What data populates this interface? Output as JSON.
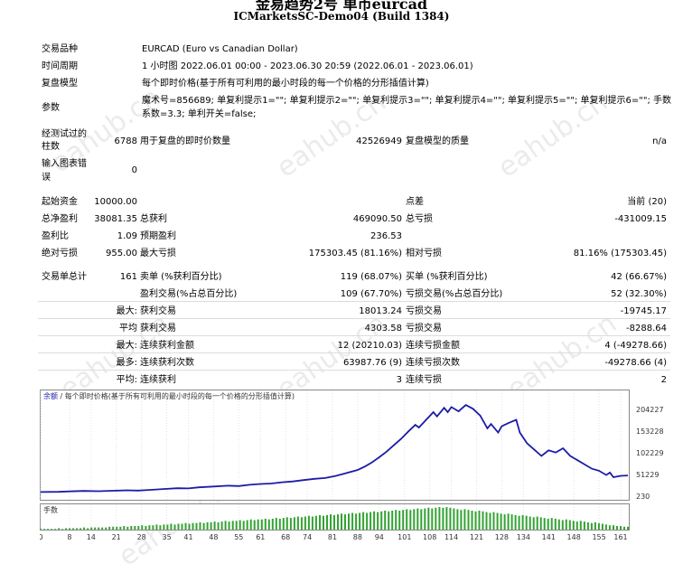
{
  "header": {
    "title": "金易趋势2号 单币eurcad",
    "subtitle": "ICMarketsSC-Demo04 (Build 1384)"
  },
  "watermark": "eahub.cn",
  "settings": {
    "symbol_label": "交易品种",
    "symbol_value": "EURCAD (Euro vs Canadian Dollar)",
    "period_label": "时间周期",
    "period_value": "1 小时图 2022.06.01 00:00 - 2023.06.30 20:59 (2022.06.01 - 2023.06.01)",
    "model_label": "复盘模型",
    "model_value": "每个即时价格(基于所有可利用的最小时段的每一个价格的分形插值计算)",
    "params_label": "参数",
    "params_line1": "魔术号=856689; 单复利提示1=\"\"; 单复利提示2=\"\"; 单复利提示3=\"\"; 单复利提示4=\"\"; 单复利提示5=\"\"; 单复利提示6=\"\"; 手数",
    "params_line2": "系数=3.3; 单利开关=false;"
  },
  "quality": {
    "bars_label_1": "经测试过的",
    "bars_label_2": "柱数",
    "bars_value": "6788",
    "ticks_label": "用于复盘的即时价数量",
    "ticks_value": "42526949",
    "model_quality_label": "复盘模型的质量",
    "model_quality_value": "n/a",
    "errors_label_1": "输入图表错",
    "errors_label_2": "误",
    "errors_value": "0"
  },
  "stats": {
    "initial_deposit_label": "起始资金",
    "initial_deposit_value": "10000.00",
    "spread_label": "点差",
    "spread_value": "当前 (20)",
    "net_profit_label": "总净盈利",
    "net_profit_value": "38081.35",
    "gross_profit_label": "总获利",
    "gross_profit_value": "469090.50",
    "gross_loss_label": "总亏损",
    "gross_loss_value": "-431009.15",
    "profit_factor_label": "盈利比",
    "profit_factor_value": "1.09",
    "expected_payoff_label": "预期盈利",
    "expected_payoff_value": "236.53",
    "abs_drawdown_label": "绝对亏损",
    "abs_drawdown_value": "955.00",
    "max_drawdown_label": "最大亏损",
    "max_drawdown_value": "175303.45 (81.16%)",
    "rel_drawdown_label": "相对亏损",
    "rel_drawdown_value": "81.16% (175303.45)"
  },
  "trades": {
    "total_label": "交易单总计",
    "total_value": "161",
    "short_label": "卖单 (%获利百分比)",
    "short_value": "119 (68.07%)",
    "long_label": "买单 (%获利百分比)",
    "long_value": "42 (66.67%)",
    "profit_trades_label": "盈利交易(%占总百分比)",
    "profit_trades_value": "109 (67.70%)",
    "loss_trades_label": "亏损交易(%占总百分比)",
    "loss_trades_value": "52 (32.30%)",
    "largest_label": "最大:",
    "largest_profit_label": "获利交易",
    "largest_profit_value": "18013.24",
    "largest_loss_label": "亏损交易",
    "largest_loss_value": "-19745.17",
    "average_label": "平均",
    "average_profit_label": "获利交易",
    "average_profit_value": "4303.58",
    "average_loss_label": "亏损交易",
    "average_loss_value": "-8288.64",
    "max_consec_label": "最大:",
    "max_consec_wins_label": "连续获利金额",
    "max_consec_wins_value": "12 (20210.03)",
    "max_consec_losses_label": "连续亏损金额",
    "max_consec_losses_value": "4 (-49278.66)",
    "max_consec_profit_label": "最多:",
    "max_consec_profit_text": "连续获利次数",
    "max_consec_profit_value": "63987.76 (9)",
    "max_consec_loss_text": "连续亏损次数",
    "max_consec_loss_value": "-49278.66 (4)",
    "avg_consec_label": "平均:",
    "avg_consec_wins_label": "连续获利",
    "avg_consec_wins_value": "3",
    "avg_consec_losses_label": "连续亏损",
    "avg_consec_losses_value": "2"
  },
  "chart_data": {
    "type": "line",
    "legend": "余额 / 每个即时价格(基于所有可利用的最小时段的每一个价格的分形插值计算)",
    "legend_balance": "余额",
    "legend_rest": " / 每个即时价格(基于所有可利用的最小时段的每一个价格的分形插值计算)",
    "volume_label": "手数",
    "ylim": [
      230,
      230000
    ],
    "yticks": [
      "204227",
      "153228",
      "102229",
      "51229",
      "230"
    ],
    "ytick_values": [
      204227,
      153228,
      102229,
      51229,
      230
    ],
    "xticks": [
      "0",
      "8",
      "14",
      "21",
      "28",
      "35",
      "41",
      "48",
      "55",
      "61",
      "68",
      "74",
      "81",
      "88",
      "94",
      "101",
      "108",
      "114",
      "121",
      "128",
      "134",
      "141",
      "148",
      "155",
      "161"
    ],
    "xlim": [
      0,
      163
    ],
    "color_line": "#1c1ca8",
    "color_volume": "#33a333",
    "balance": [
      [
        0,
        10000
      ],
      [
        5,
        10500
      ],
      [
        8,
        11500
      ],
      [
        12,
        12500
      ],
      [
        16,
        12000
      ],
      [
        20,
        13000
      ],
      [
        24,
        14000
      ],
      [
        27,
        13500
      ],
      [
        30,
        15000
      ],
      [
        34,
        17000
      ],
      [
        38,
        19000
      ],
      [
        41,
        18500
      ],
      [
        44,
        21000
      ],
      [
        48,
        23000
      ],
      [
        52,
        25000
      ],
      [
        55,
        24000
      ],
      [
        58,
        27000
      ],
      [
        61,
        29000
      ],
      [
        64,
        30000
      ],
      [
        67,
        33000
      ],
      [
        70,
        35000
      ],
      [
        73,
        38000
      ],
      [
        76,
        41000
      ],
      [
        79,
        43000
      ],
      [
        82,
        48000
      ],
      [
        85,
        55000
      ],
      [
        88,
        62000
      ],
      [
        90,
        70000
      ],
      [
        92,
        80000
      ],
      [
        94,
        92000
      ],
      [
        96,
        105000
      ],
      [
        98,
        120000
      ],
      [
        100,
        135000
      ],
      [
        102,
        152000
      ],
      [
        104,
        168000
      ],
      [
        105,
        162000
      ],
      [
        107,
        180000
      ],
      [
        109,
        198000
      ],
      [
        110,
        188000
      ],
      [
        112,
        208000
      ],
      [
        113,
        198000
      ],
      [
        114,
        210000
      ],
      [
        116,
        200000
      ],
      [
        118,
        215000
      ],
      [
        120,
        206000
      ],
      [
        122,
        190000
      ],
      [
        124,
        160000
      ],
      [
        125,
        170000
      ],
      [
        127,
        150000
      ],
      [
        128,
        165000
      ],
      [
        130,
        173000
      ],
      [
        132,
        180000
      ],
      [
        133,
        150000
      ],
      [
        135,
        125000
      ],
      [
        137,
        110000
      ],
      [
        139,
        95000
      ],
      [
        141,
        108000
      ],
      [
        143,
        103000
      ],
      [
        145,
        113000
      ],
      [
        147,
        95000
      ],
      [
        149,
        85000
      ],
      [
        151,
        75000
      ],
      [
        153,
        65000
      ],
      [
        155,
        60000
      ],
      [
        157,
        50000
      ],
      [
        158,
        56000
      ],
      [
        159,
        45000
      ],
      [
        161,
        48000
      ],
      [
        163,
        49000
      ]
    ],
    "volume": [
      1,
      1,
      1,
      1,
      1,
      2,
      1,
      2,
      2,
      2,
      2,
      2,
      3,
      2,
      3,
      3,
      3,
      3,
      3,
      4,
      4,
      4,
      4,
      5,
      4,
      5,
      5,
      5,
      6,
      5,
      6,
      6,
      7,
      6,
      7,
      7,
      8,
      7,
      8,
      8,
      9,
      8,
      9,
      9,
      10,
      9,
      10,
      10,
      11,
      10,
      11,
      12,
      11,
      12,
      12,
      13,
      12,
      13,
      14,
      13,
      14,
      14,
      15,
      14,
      15,
      16,
      15,
      16,
      17,
      16,
      17,
      18,
      17,
      18,
      19,
      18,
      19,
      20,
      19,
      20,
      21,
      20,
      21,
      22,
      21,
      22,
      23,
      22,
      23,
      24,
      23,
      24,
      25,
      24,
      25,
      26,
      25,
      26,
      27,
      26,
      27,
      28,
      27,
      28,
      29,
      28,
      29,
      30,
      29,
      30,
      31,
      30,
      31,
      30,
      29,
      28,
      27,
      28,
      27,
      26,
      25,
      26,
      25,
      24,
      23,
      24,
      23,
      22,
      21,
      22,
      21,
      20,
      19,
      20,
      19,
      18,
      17,
      18,
      17,
      16,
      15,
      16,
      15,
      14,
      13,
      14,
      13,
      12,
      11,
      12,
      11,
      10,
      9,
      10,
      9,
      8,
      7,
      6,
      6,
      5,
      5,
      4,
      4
    ]
  }
}
